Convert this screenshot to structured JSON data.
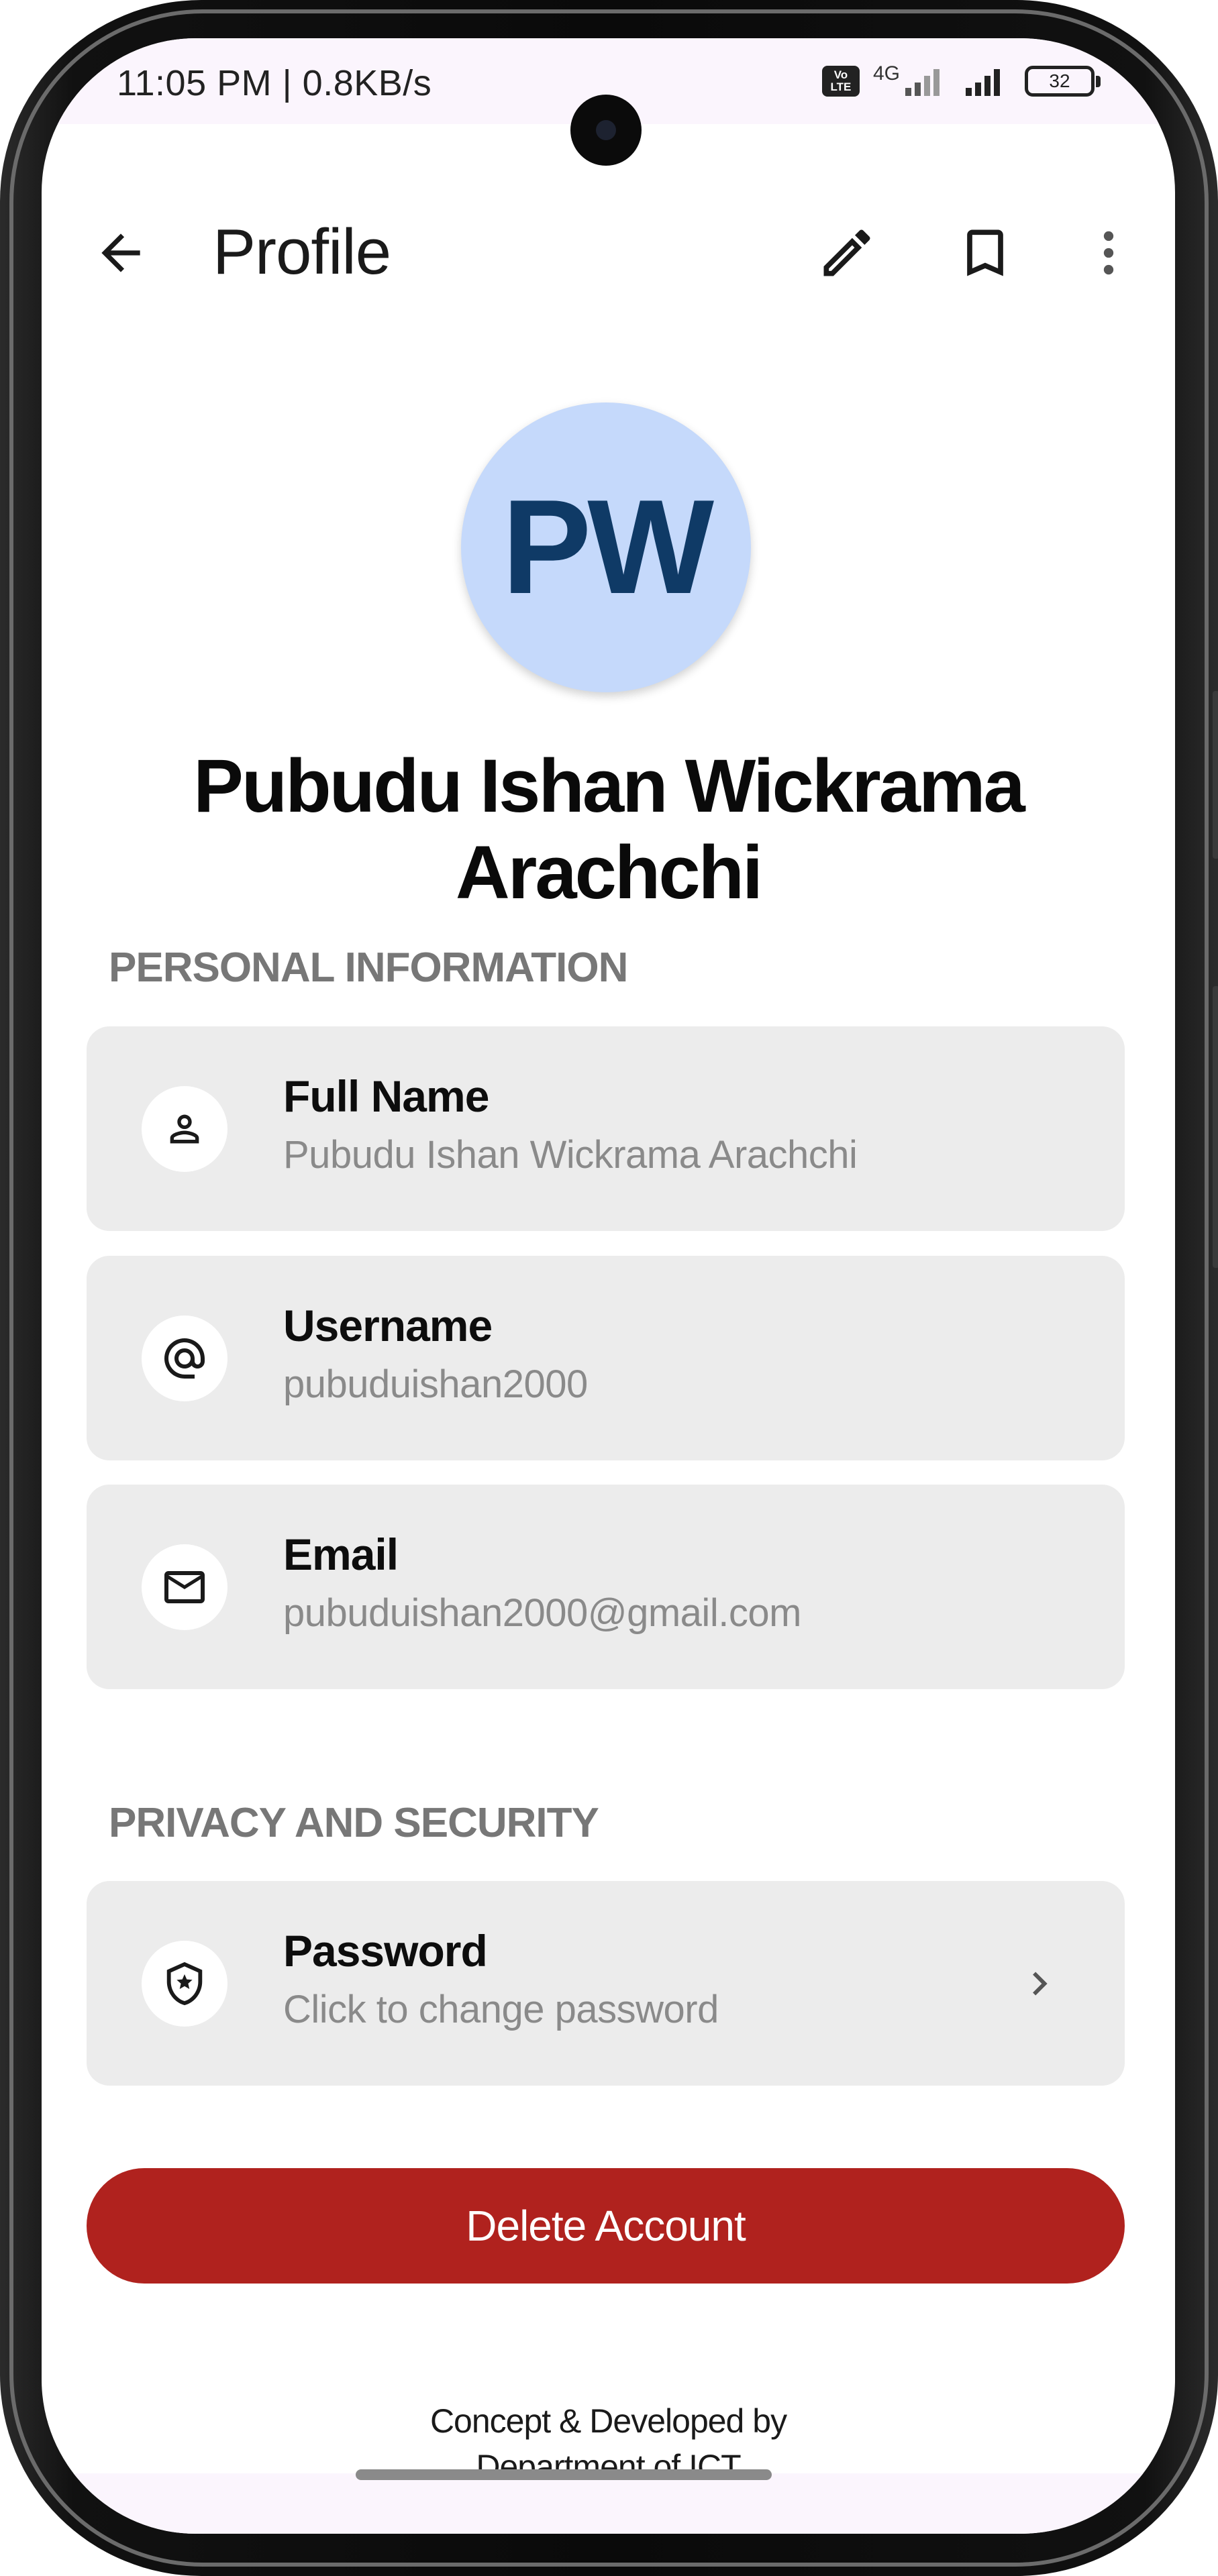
{
  "status_bar": {
    "time_speed": "11:05 PM | 0.8KB/s",
    "volte_top": "Vo",
    "volte_bottom": "LTE",
    "network": "4G",
    "battery": "32"
  },
  "app_bar": {
    "title": "Profile",
    "icons": [
      "back-arrow-icon",
      "edit-pencil-icon",
      "bookmark-icon",
      "more-vert-icon"
    ]
  },
  "profile": {
    "initials": "PW",
    "name": "Pubudu Ishan Wickrama Arachchi"
  },
  "personal_information": {
    "title": "PERSONAL INFORMATION",
    "items": [
      {
        "label": "Full Name",
        "value": "Pubudu Ishan Wickrama Arachchi",
        "icon": "person-icon"
      },
      {
        "label": "Username",
        "value": "pubuduishan2000",
        "icon": "at-sign-icon"
      },
      {
        "label": "Email",
        "value": "pubuduishan2000@gmail.com",
        "icon": "mail-icon"
      }
    ]
  },
  "privacy_security": {
    "title": "PRIVACY AND SECURITY",
    "items": [
      {
        "label": "Password",
        "value": "Click to change password",
        "icon": "shield-icon"
      }
    ]
  },
  "actions": {
    "delete_label": "Delete Account"
  },
  "footer": {
    "line1": "Concept & Developed by",
    "line2": "Department of ICT"
  },
  "colors": {
    "avatar_bg": "#c5d9fb",
    "avatar_text": "#0f3a66",
    "card_bg": "#ececec",
    "danger": "#b0221e",
    "section_title": "#777777"
  }
}
